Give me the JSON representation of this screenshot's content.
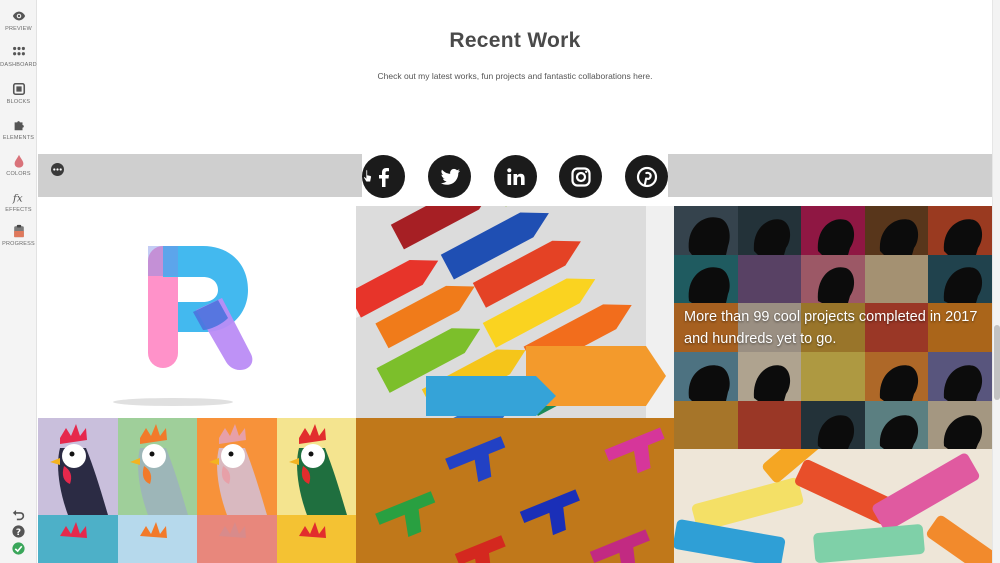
{
  "sidebar": {
    "items": [
      {
        "label": "PREVIEW",
        "icon": "eye-icon"
      },
      {
        "label": "DASHBOARD",
        "icon": "grid-icon"
      },
      {
        "label": "BLOCKS",
        "icon": "blocks-icon"
      },
      {
        "label": "ELEMENTS",
        "icon": "puzzle-icon"
      },
      {
        "label": "COLORS",
        "icon": "drop-icon"
      },
      {
        "label": "EFFECTS",
        "icon": "fx-icon"
      },
      {
        "label": "PROGRESS",
        "icon": "clipboard-icon"
      }
    ],
    "bottom_icons": [
      "undo-icon",
      "help-icon",
      "check-icon"
    ]
  },
  "section": {
    "title": "Recent Work",
    "subtitle": "Check out my latest works, fun projects and fantastic collaborations here."
  },
  "social": {
    "networks": [
      "facebook-icon",
      "twitter-icon",
      "linkedin-icon",
      "instagram-icon",
      "pinterest-icon"
    ],
    "bar_color": "#cfcfcf",
    "icon_color": "#1b1b1b"
  },
  "portfolio": {
    "overlay_text": "More than 99 cool projects completed in 2017 and hundreds yet to go.",
    "tiles": [
      "r-logo",
      "crayons",
      "heads",
      "roosters",
      "toy-guns",
      "chalk"
    ]
  }
}
